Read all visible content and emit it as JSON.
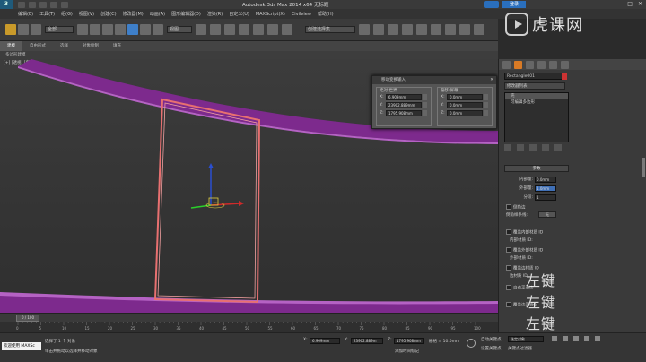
{
  "window": {
    "title": "Autodesk 3ds Max  2014 x64    无标题",
    "login_label": "登录",
    "controls": [
      "—",
      "□",
      "✕"
    ]
  },
  "menu": [
    "编辑(E)",
    "工具(T)",
    "组(G)",
    "视图(V)",
    "创建(C)",
    "修改器(M)",
    "动画(A)",
    "图形编辑器(D)",
    "渲染(R)",
    "自定义(U)",
    "MAXScript(X)",
    "Civilview",
    "帮助(H)"
  ],
  "toolbar": {
    "filter_value": "全部",
    "view_value": "视图",
    "selection_set_placeholder": "创建选择集"
  },
  "ribbon": {
    "tabs": [
      "建模",
      "自由形式",
      "选择",
      "对象绘制",
      "填充"
    ],
    "active_tab": 0,
    "subtool_label": "多边形建模"
  },
  "viewport": {
    "label": "[+] [透视] [真实]",
    "accent_purple": "#7a1f8a",
    "rect_color": "#e87070"
  },
  "dialog": {
    "title": "移动变换输入",
    "close": "✕",
    "absolute": {
      "title": "绝对:世界",
      "rows": [
        {
          "axis": "X:",
          "value": "6.909mm"
        },
        {
          "axis": "Y:",
          "value": "23902.889mm"
        },
        {
          "axis": "Z:",
          "value": "1795.908mm"
        }
      ]
    },
    "offset": {
      "title": "偏移:屏幕",
      "rows": [
        {
          "axis": "X:",
          "value": "0.0mm"
        },
        {
          "axis": "Y:",
          "value": "0.0mm"
        },
        {
          "axis": "Z:",
          "value": "0.0mm"
        }
      ]
    }
  },
  "command_panel": {
    "object_name": "Rectangle001",
    "modifier_list": "修改器列表",
    "stack_items": [
      "壳",
      "可编辑多边形"
    ],
    "params_title": "参数",
    "params": [
      {
        "label": "内部量:",
        "value": "0.0mm"
      },
      {
        "label": "外部量:",
        "value": "1.0mm"
      },
      {
        "label": "分段:",
        "value": "1"
      }
    ],
    "options": [
      "倒角边",
      "覆盖内部材质 ID",
      "覆盖外部材质 ID",
      "覆盖边材质 ID",
      "自动平滑边",
      "覆盖边平滑组"
    ],
    "bevel_spline_label": "倒角样条线:",
    "bevel_spline_value": "无",
    "inner_mat_label": "内部材质 ID:",
    "outer_mat_label": "外部材质 ID:",
    "edge_mat_label": "边材质 ID:",
    "accent_orange": "#d87a25",
    "accent_blue": "#3f6fb5"
  },
  "watermark": {
    "logo_text": "虎课网",
    "key_labels": [
      "左键",
      "左键",
      "左键"
    ]
  },
  "timeline": {
    "frame_label": "0 / 100",
    "ticks": [
      "0",
      "5",
      "10",
      "15",
      "20",
      "25",
      "30",
      "35",
      "40",
      "45",
      "50",
      "55",
      "60",
      "65",
      "70",
      "75",
      "80",
      "85",
      "90",
      "95",
      "100"
    ]
  },
  "status": {
    "welcome": "欢迎使用 MAXSc",
    "line1": "选择了 1 个 对象",
    "line2": "单击并拖动以选择并移动对象",
    "x_label": "X:",
    "x_value": "6.909mm",
    "y_label": "Y:",
    "y_value": "23902.889m",
    "z_label": "Z:",
    "z_value": "1795.908mm",
    "grid": "栅格 = 10.0mm",
    "add_time_tag": "添加时间标记",
    "auto_key": "自动关键点",
    "set_key": "设置关键点",
    "selected_obj": "选定对象",
    "key_filter": "关键点过滤器..."
  }
}
